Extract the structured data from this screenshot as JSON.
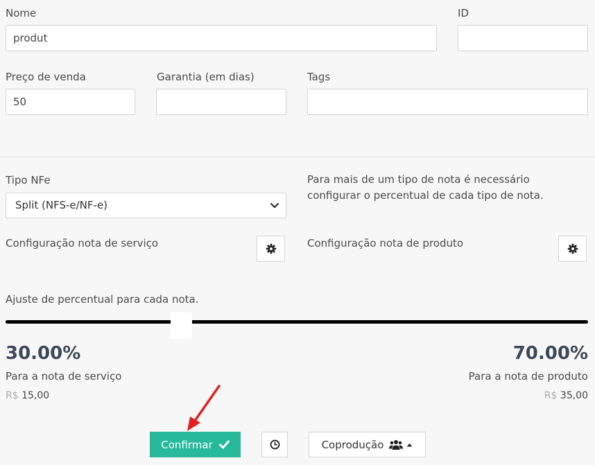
{
  "form": {
    "nome": {
      "label": "Nome",
      "value": "produt"
    },
    "id": {
      "label": "ID",
      "value": ""
    },
    "preco": {
      "label": "Preço de venda",
      "value": "50"
    },
    "garantia": {
      "label": "Garantia (em dias)",
      "value": ""
    },
    "tags": {
      "label": "Tags",
      "value": ""
    }
  },
  "nfe": {
    "label": "Tipo NFe",
    "selected": "Split (NFS-e/NF-e)",
    "note_line1": "Para mais de um tipo de nota é necessário",
    "note_line2": "configurar o percentual de cada tipo de nota.",
    "config_servico": "Configuração nota de serviço",
    "config_produto": "Configuração nota de produto"
  },
  "split": {
    "label": "Ajuste de percentual para cada nota.",
    "slider_value": 0.3,
    "servico": {
      "percent": "30.00%",
      "caption": "Para a nota de serviço",
      "currency": "R$",
      "amount": "15,00"
    },
    "produto": {
      "percent": "70.00%",
      "caption": "Para a nota de produto",
      "currency": "R$",
      "amount": "35,00"
    }
  },
  "actions": {
    "confirm_label": "Confirmar",
    "coproducao_label": "Coprodução"
  },
  "colors": {
    "confirm_bg": "#26b99a",
    "arrow": "#e02020",
    "percent_text": "#3c4858"
  },
  "icons": {
    "confirm": "check-icon",
    "history": "clock-icon",
    "coproducao": "users-icon",
    "dropdown": "caret-down-icon",
    "config": "gear-icon"
  }
}
